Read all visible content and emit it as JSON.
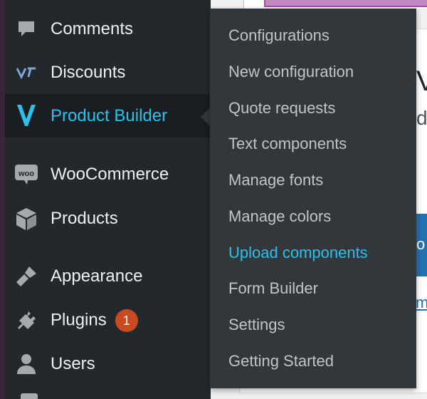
{
  "menu": {
    "items": [
      {
        "label": "Comments",
        "icon": "comment-icon"
      },
      {
        "label": "Discounts",
        "icon": "discounts-logo-icon"
      },
      {
        "label": "Product Builder",
        "icon": "product-builder-logo-icon",
        "current": true
      },
      {
        "label": "WooCommerce",
        "icon": "woocommerce-icon"
      },
      {
        "label": "Products",
        "icon": "box-icon"
      },
      {
        "label": "Appearance",
        "icon": "paintbrush-icon"
      },
      {
        "label": "Plugins",
        "icon": "plug-icon",
        "badge": "1"
      },
      {
        "label": "Users",
        "icon": "user-icon"
      }
    ]
  },
  "submenu": {
    "items": [
      {
        "label": "Configurations"
      },
      {
        "label": "New configuration"
      },
      {
        "label": "Quote requests"
      },
      {
        "label": "Text components"
      },
      {
        "label": "Manage fonts"
      },
      {
        "label": "Manage colors"
      },
      {
        "label": "Upload components",
        "active": true
      },
      {
        "label": "Form Builder"
      },
      {
        "label": "Settings"
      },
      {
        "label": "Getting Started"
      }
    ]
  },
  "content": {
    "heading_fragment": "V",
    "sub_fragment": "d",
    "button_fragment": "o",
    "link_fragment": "m"
  },
  "colors": {
    "menu_bg": "#23282d",
    "submenu_bg": "#32373c",
    "accent": "#2ec0e8",
    "badge": "#ca4a1f"
  }
}
